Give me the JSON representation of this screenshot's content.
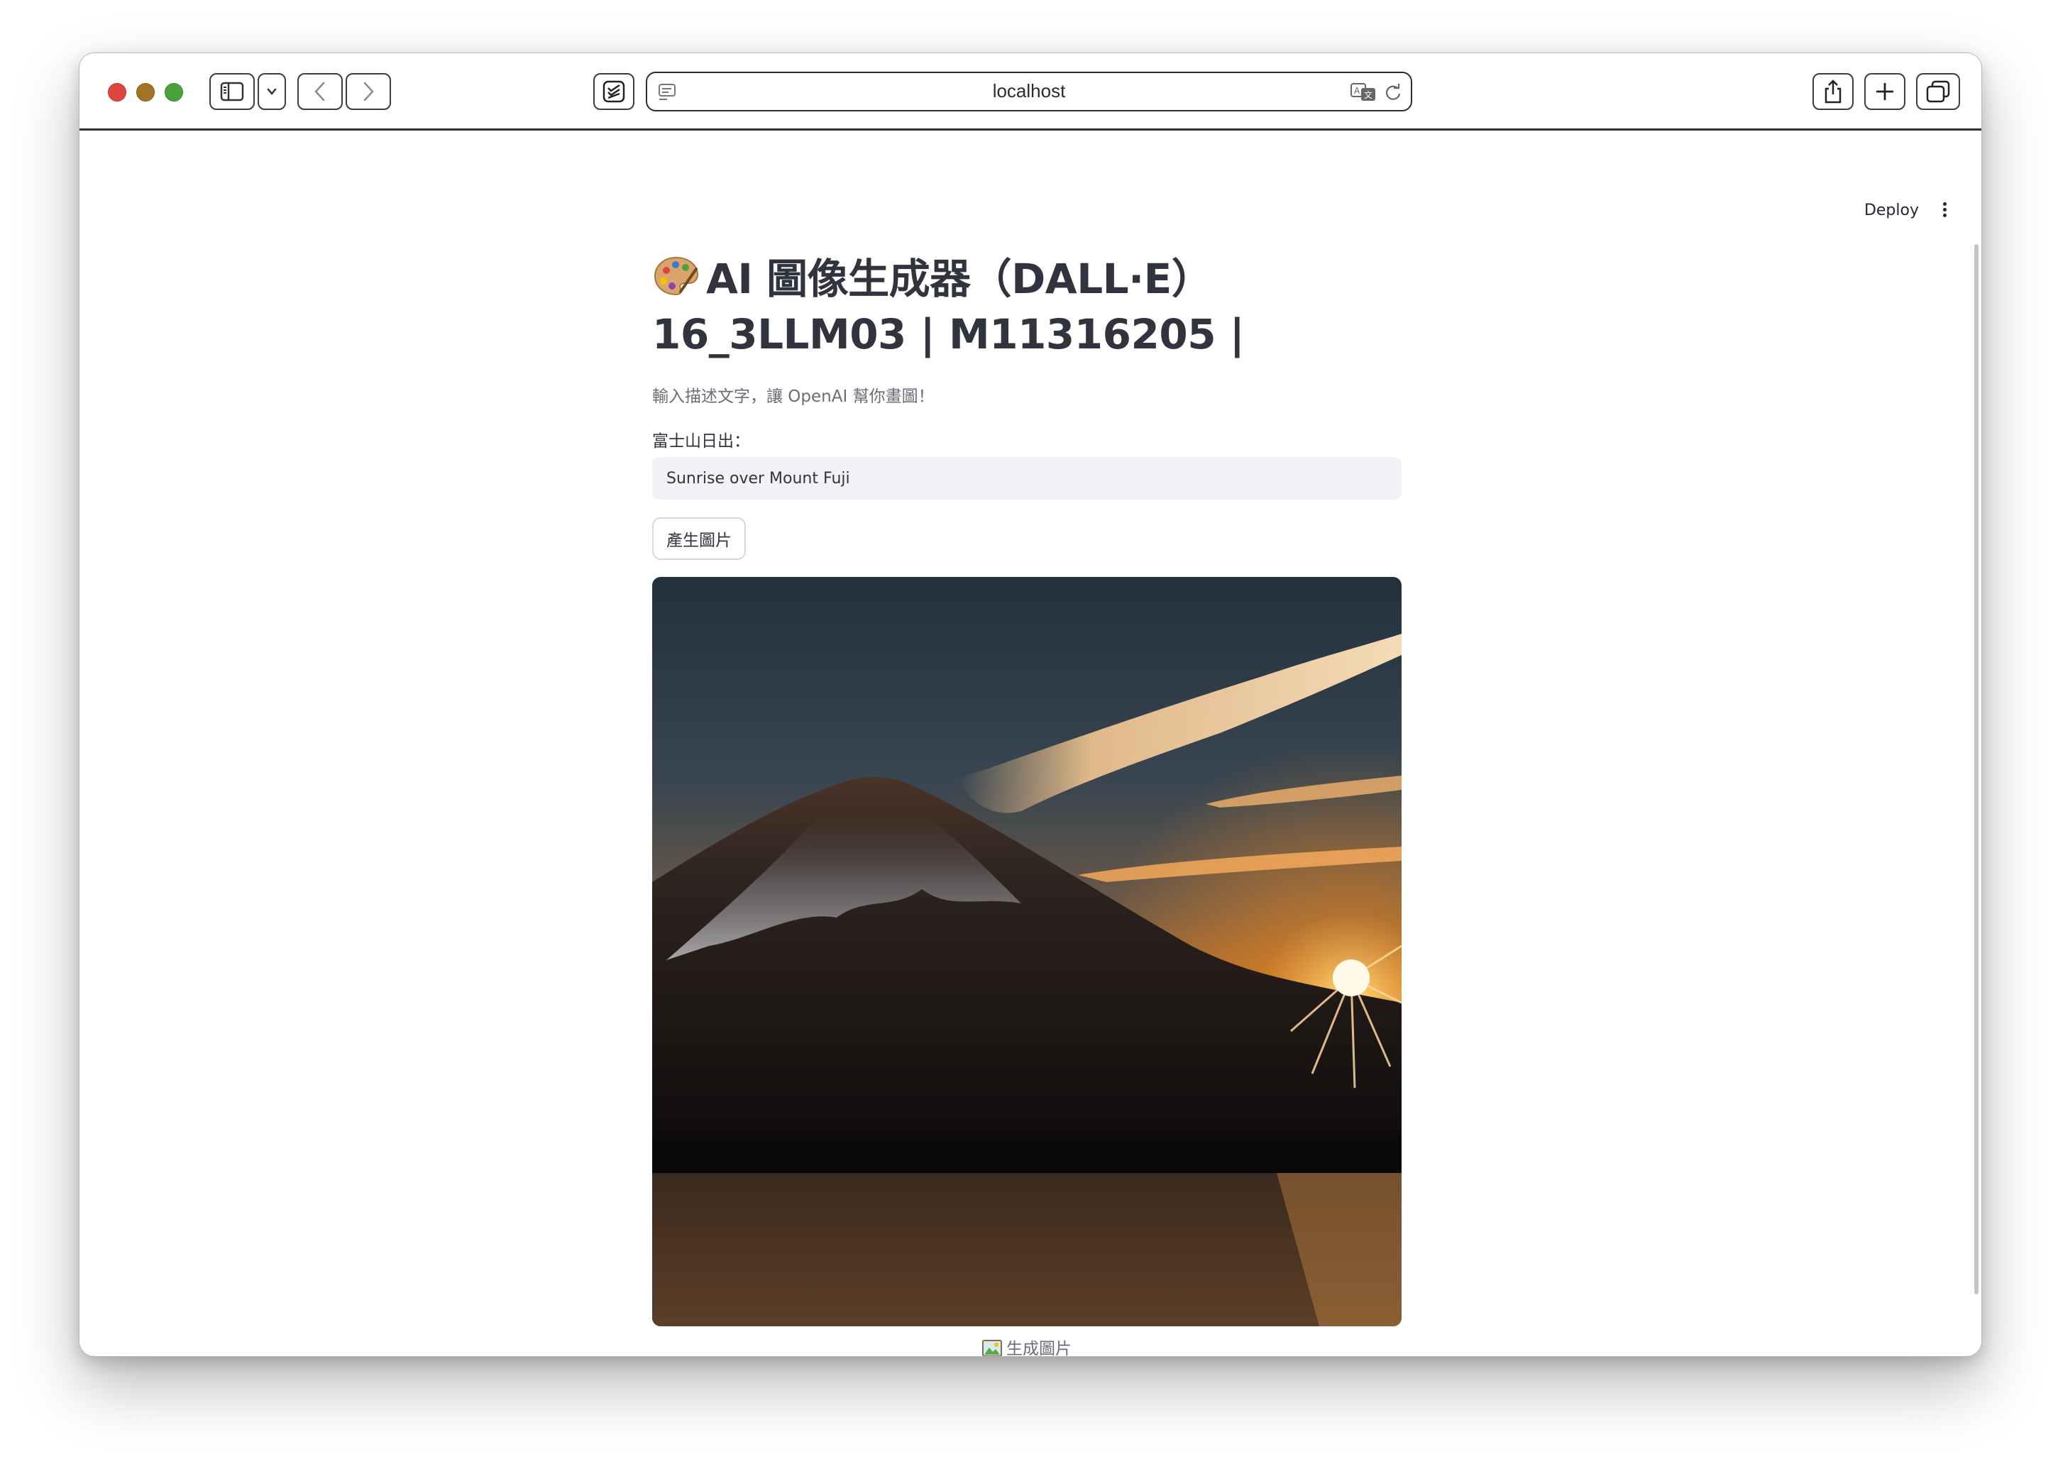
{
  "browser": {
    "url": "localhost"
  },
  "app_header": {
    "deploy_label": "Deploy"
  },
  "main": {
    "title_line1": "AI 圖像生成器（DALL·E）",
    "title_line2": "16_3LLM03 | M11316205 |",
    "subtitle": "輸入描述文字，讓 OpenAI 幫你畫圖！",
    "input_label": "富士山日出：",
    "input_value": "Sunrise over Mount Fuji",
    "generate_button": "產生圖片",
    "image_caption": "生成圖片"
  },
  "colors": {
    "text_primary": "#31333f",
    "text_secondary": "#6b6d76",
    "input_bg": "#f0f2f6"
  },
  "icons": [
    "palette-icon",
    "sidebar-toggle-icon",
    "chevron-down-icon",
    "back-icon",
    "forward-icon",
    "reader-icon",
    "page-settings-icon",
    "translate-icon",
    "reload-icon",
    "share-icon",
    "new-tab-icon",
    "tab-overview-icon",
    "more-vertical-icon",
    "picture-icon"
  ]
}
